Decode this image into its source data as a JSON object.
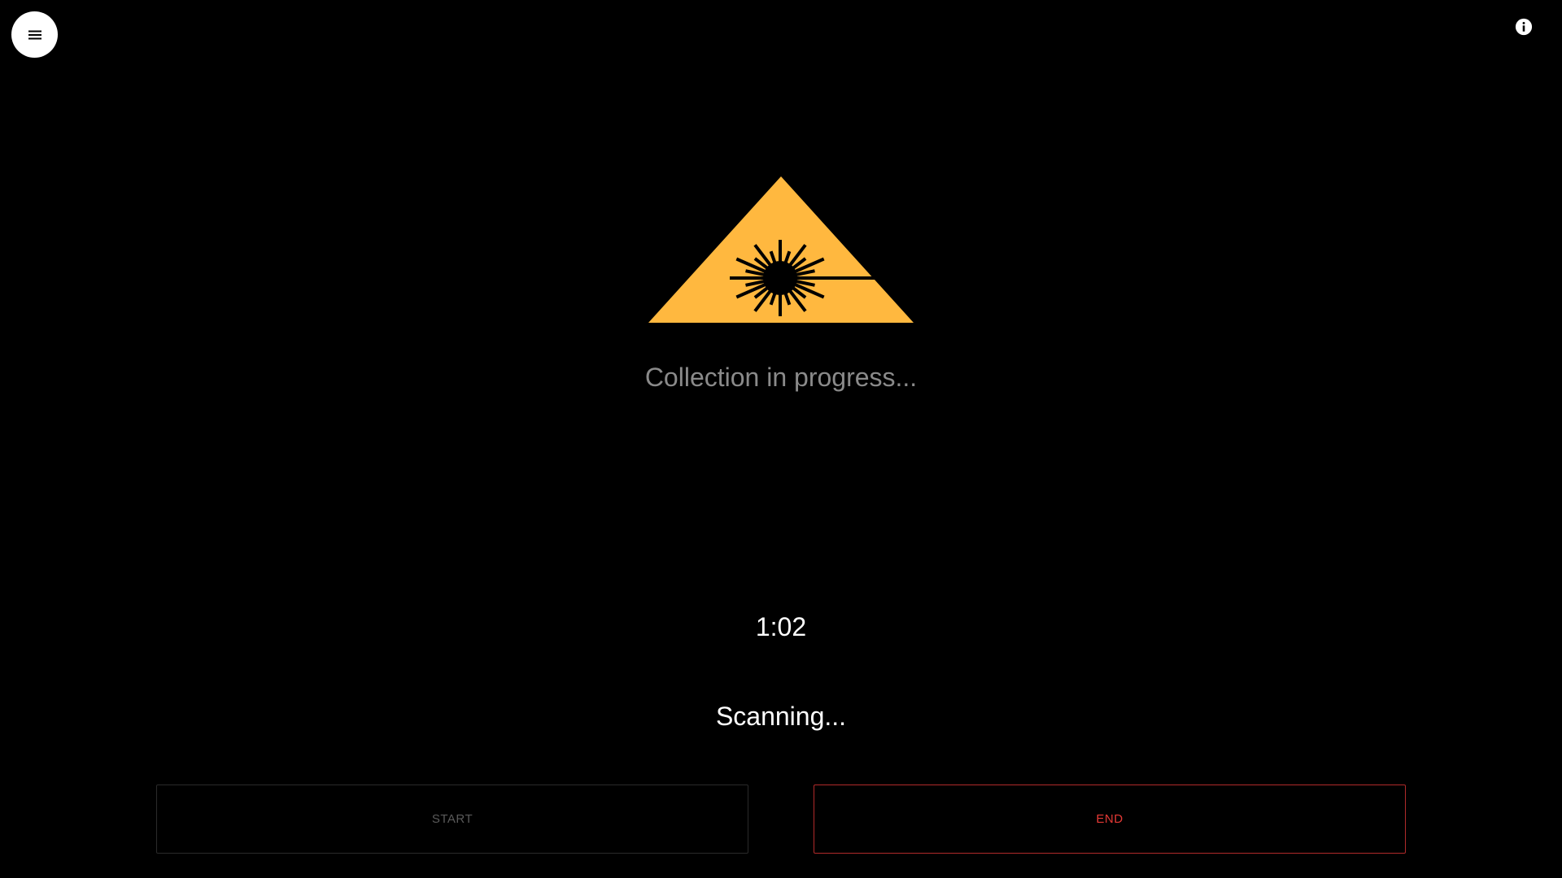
{
  "header": {
    "menu_icon": "hamburger-menu-icon",
    "info_icon": "info-icon"
  },
  "main": {
    "warning_icon": "laser-warning-icon",
    "collection_text": "Collection in progress...",
    "timer": "1:02",
    "status": "Scanning..."
  },
  "actions": {
    "start_label": "START",
    "end_label": "END",
    "start_enabled": false
  },
  "colors": {
    "background": "#000000",
    "warning_yellow": "#FFB83F",
    "end_accent": "#e53935",
    "disabled_text": "#5a5a5a"
  }
}
